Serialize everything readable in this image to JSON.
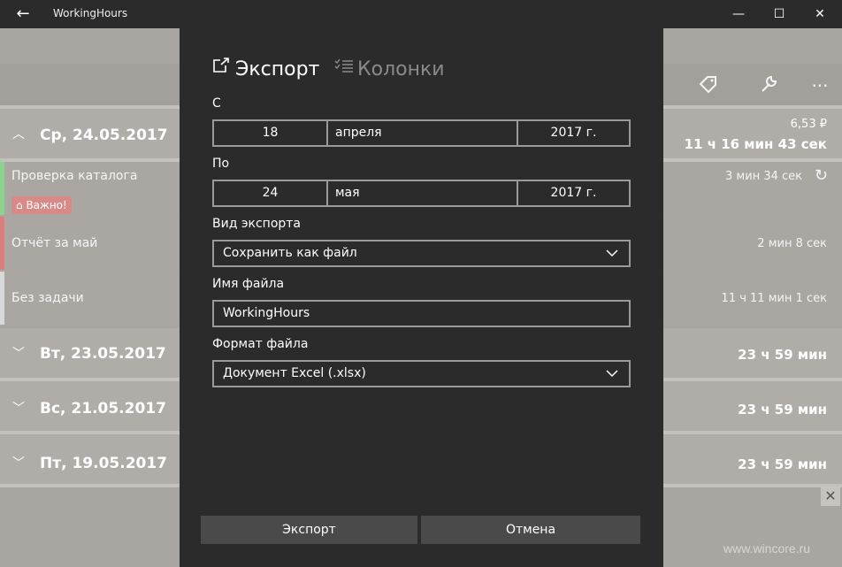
{
  "titlebar": {
    "title": "WorkingHours",
    "back_icon": "←",
    "min_icon": "—",
    "max_icon": "☐",
    "close_icon": "✕"
  },
  "toolbar": {
    "tag_icon": "⌂",
    "wrench_icon": "🔧",
    "more_icon": "···"
  },
  "days": [
    {
      "date": "Ср, 24.05.2017",
      "money": "6,53 ₽",
      "duration": "11 ч 16 мин 43 сек",
      "expanded": true
    },
    {
      "date": "Вт, 23.05.2017",
      "duration": "23 ч 59 мин",
      "expanded": false
    },
    {
      "date": "Вс, 21.05.2017",
      "duration": "23 ч 59 мин",
      "expanded": false
    },
    {
      "date": "Пт, 19.05.2017",
      "duration": "23 ч 59 мин",
      "expanded": false
    }
  ],
  "tasks": [
    {
      "name": "Проверка каталога",
      "time": "3 мин 34 сек",
      "badge": "Важно!",
      "bar_color": "#8fcf8f",
      "running_icon": "↻"
    },
    {
      "name": "Отчёт за май",
      "time": "2 мин 8 сек",
      "bar_color": "#d9807e"
    },
    {
      "name": "Без задачи",
      "time": "11 ч 11 мин 1 сек",
      "bar_color": "#d8d8d8"
    }
  ],
  "ad_close": "✕",
  "watermark": "www.wincore.ru",
  "dialog": {
    "tab_export": "Экспорт",
    "tab_columns": "Колонки",
    "from_label": "С",
    "from": {
      "day": "18",
      "month": "апреля",
      "year": "2017 г."
    },
    "to_label": "По",
    "to": {
      "day": "24",
      "month": "мая",
      "year": "2017 г."
    },
    "export_type_label": "Вид экспорта",
    "export_type": "Сохранить как файл",
    "filename_label": "Имя файла",
    "filename": "WorkingHours",
    "format_label": "Формат файла",
    "format": "Документ Excel (.xlsx)",
    "export_button": "Экспорт",
    "cancel_button": "Отмена"
  }
}
